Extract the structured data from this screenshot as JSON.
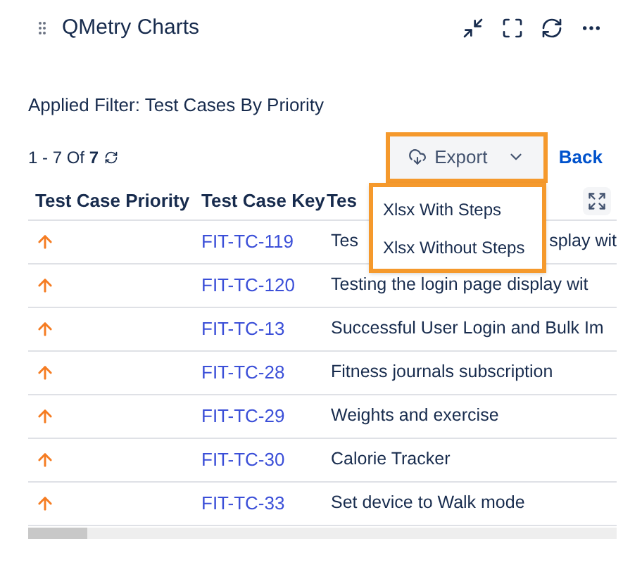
{
  "title": "QMetry Charts",
  "filter": "Applied Filter: Test Cases By Priority",
  "pagination": {
    "range": "1 - 7 Of",
    "total": "7"
  },
  "export": {
    "label": "Export",
    "expanded": true,
    "options": [
      "Xlsx With Steps",
      "Xlsx Without Steps"
    ]
  },
  "back": "Back",
  "table": {
    "columns": [
      "Test Case Priority",
      "Test Case Key",
      "Tes"
    ],
    "rows": [
      {
        "key": "FIT-TC-119",
        "summary": "Tes",
        "summary_tail": "splay wit"
      },
      {
        "key": "FIT-TC-120",
        "summary": "Testing the login page display wit"
      },
      {
        "key": "FIT-TC-13",
        "summary": "Successful User Login and Bulk Im"
      },
      {
        "key": "FIT-TC-28",
        "summary": "Fitness journals subscription"
      },
      {
        "key": "FIT-TC-29",
        "summary": "Weights and exercise"
      },
      {
        "key": "FIT-TC-30",
        "summary": "Calorie Tracker"
      },
      {
        "key": "FIT-TC-33",
        "summary": "Set device to Walk mode"
      }
    ]
  }
}
